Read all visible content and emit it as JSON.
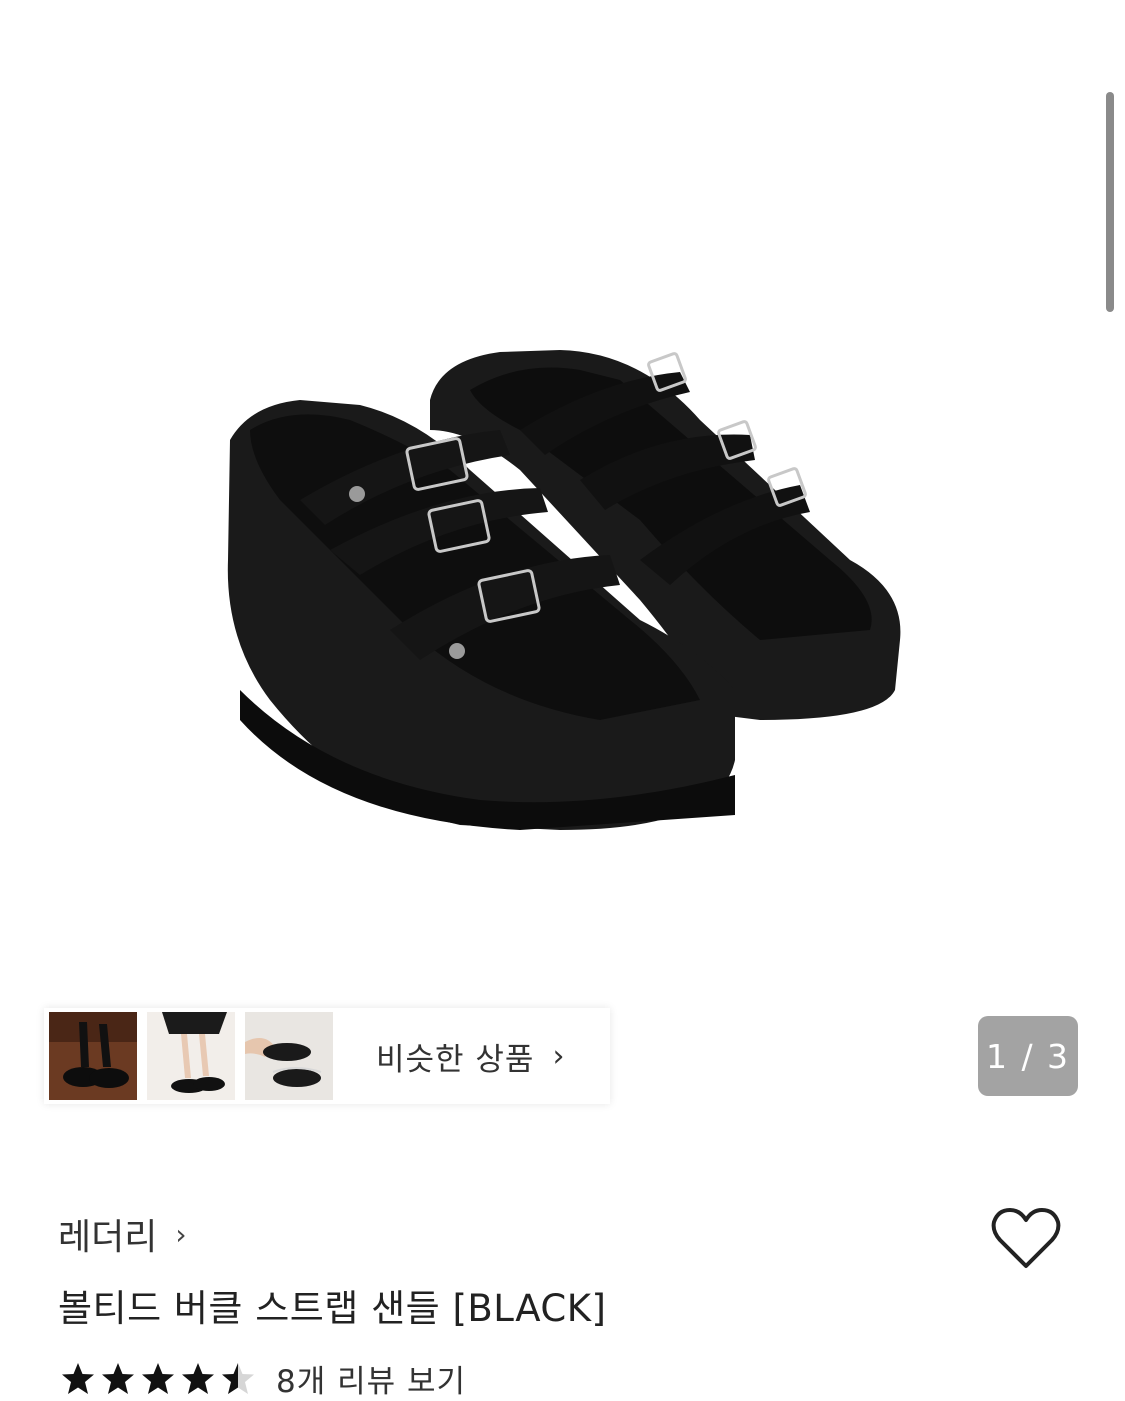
{
  "gallery": {
    "counter_current": "1",
    "counter_total": "3",
    "counter_text": "1 / 3",
    "similar_label": "비슷한 상품",
    "thumbnails": [
      "thumb-1",
      "thumb-2",
      "thumb-3"
    ]
  },
  "product": {
    "brand": "레더리",
    "title": "볼티드 버클 스트랩 샌들 [BLACK]",
    "rating": 4.5,
    "review_link": "8개 리뷰 보기",
    "wishlisted": false
  },
  "icons": {
    "chevron": "chevron-right-icon",
    "heart": "heart-outline-icon",
    "star": "star-icon"
  },
  "colors": {
    "star_fill": "#111111",
    "counter_bg": "#a3a3a3",
    "text": "#222222"
  }
}
